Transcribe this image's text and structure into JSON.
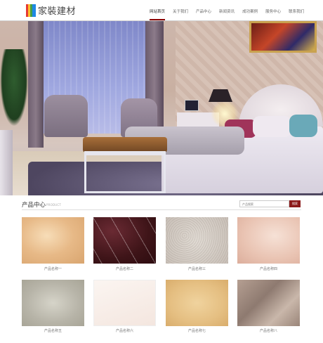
{
  "header": {
    "logo_text": "家裝建材",
    "nav": [
      "网站首页",
      "关于我们",
      "产品中心",
      "新闻资讯",
      "成功案例",
      "服务中心",
      "联系我们"
    ],
    "active_index": 0
  },
  "banner": {
    "slides": 2,
    "active_slide": 1
  },
  "products": {
    "title": "产品中心",
    "subtitle": "PRODUCT",
    "search_placeholder": "产品搜索",
    "search_button": "搜索",
    "items": [
      "产品名称一",
      "产品名称二",
      "产品名称三",
      "产品名称四",
      "产品名称五",
      "产品名称六",
      "产品名称七",
      "产品名称八"
    ]
  }
}
